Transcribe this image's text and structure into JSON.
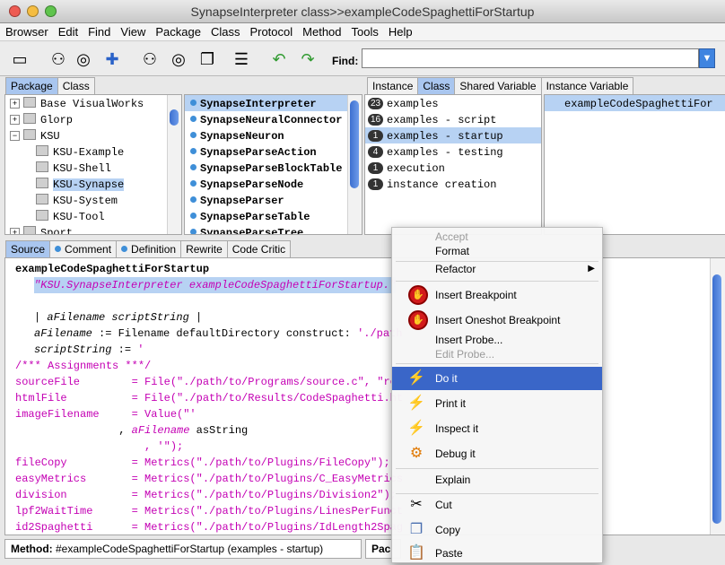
{
  "window": {
    "title": "SynapseInterpreter class>>exampleCodeSpaghettiForStartup"
  },
  "menubar": [
    "Browser",
    "Edit",
    "Find",
    "View",
    "Package",
    "Class",
    "Protocol",
    "Method",
    "Tools",
    "Help"
  ],
  "toolbar": {
    "find_label": "Find:",
    "find_value": ""
  },
  "nav_tabs": {
    "package": "Package",
    "class": "Class"
  },
  "packages": [
    {
      "label": "Base VisualWorks",
      "expander": "+"
    },
    {
      "label": "Glorp",
      "expander": "+"
    },
    {
      "label": "KSU",
      "expander": "−"
    },
    {
      "label": "KSU-Example"
    },
    {
      "label": "KSU-Shell"
    },
    {
      "label": "KSU-Synapse"
    },
    {
      "label": "KSU-System"
    },
    {
      "label": "KSU-Tool"
    },
    {
      "label": "Sport",
      "expander": "+"
    }
  ],
  "classes": [
    "SynapseInterpreter",
    "SynapseNeuralConnector",
    "SynapseNeuron",
    "SynapseParseAction",
    "SynapseParseBlockTable",
    "SynapseParseNode",
    "SynapseParser",
    "SynapseParseTable",
    "SynapseParseTree"
  ],
  "protocol_tabs": {
    "instance": "Instance",
    "class": "Class",
    "shared": "Shared Variable",
    "instvar": "Instance Variable"
  },
  "protocols": [
    {
      "count": "23",
      "label": "examples"
    },
    {
      "count": "16",
      "label": "examples - script"
    },
    {
      "count": "1",
      "label": "examples - startup"
    },
    {
      "count": "4",
      "label": "examples - testing"
    },
    {
      "count": "1",
      "label": "execution"
    },
    {
      "count": "1",
      "label": "instance creation"
    }
  ],
  "methods": [
    "exampleCodeSpaghettiFor"
  ],
  "code_tabs": {
    "source": "Source",
    "comment": "Comment",
    "definition": "Definition",
    "rewrite": "Rewrite",
    "critic": "Code Critic"
  },
  "code": {
    "l1": "exampleCodeSpaghettiForStartup",
    "l2": "\"KSU.SynapseInterpreter exampleCodeSpaghettiForStartup.\"",
    "l4a": "| ",
    "l4b": "aFilename scriptString",
    "l4c": " |",
    "l5a": "aFilename",
    "l5b": " := Filename defaultDirectory construct: ",
    "l5c": "'./path",
    "l6a": "scriptString",
    "l6b": " := ",
    "l6c": "'",
    "l7": "/*** Assignments ***/",
    "l8": "sourceFile        = File(\"./path/to/Programs/source.c\", \"rea",
    "l9": "htmlFile          = File(\"./path/to/Results/CodeSpaghetti.ht",
    "l10": "imageFilename     = Value(\"'",
    "l11a": "                , ",
    "l11b": "aFilename",
    "l11c": " asString",
    "l12": "                    , '\");",
    "l13": "fileCopy          = Metrics(\"./path/to/Plugins/FileCopy\");",
    "l14": "easyMetrics       = Metrics(\"./path/to/Plugins/C_EasyMetrics",
    "l15": "division          = Metrics(\"./path/to/Plugins/Division2\");",
    "l16": "lpf2WaitTime      = Metrics(\"./path/to/Plugins/LinesPerFunct",
    "l17": "id2Spaghetti      = Metrics(\"./path/to/Plugins/IdLength2Spag"
  },
  "status": {
    "method_label": "Method:",
    "method_value": " #exampleCodeSpaghettiForStartup (examples - startup)",
    "right": "Pac"
  },
  "context_menu": {
    "accept": "Accept",
    "format": "Format",
    "refactor": "Refactor",
    "insert_breakpoint": "Insert Breakpoint",
    "insert_oneshot": "Insert Oneshot Breakpoint",
    "insert_probe": "Insert Probe...",
    "edit_probe": "Edit Probe...",
    "do_it": "Do it",
    "print_it": "Print it",
    "inspect_it": "Inspect it",
    "debug_it": "Debug it",
    "explain": "Explain",
    "cut": "Cut",
    "copy": "Copy",
    "paste": "Paste"
  }
}
